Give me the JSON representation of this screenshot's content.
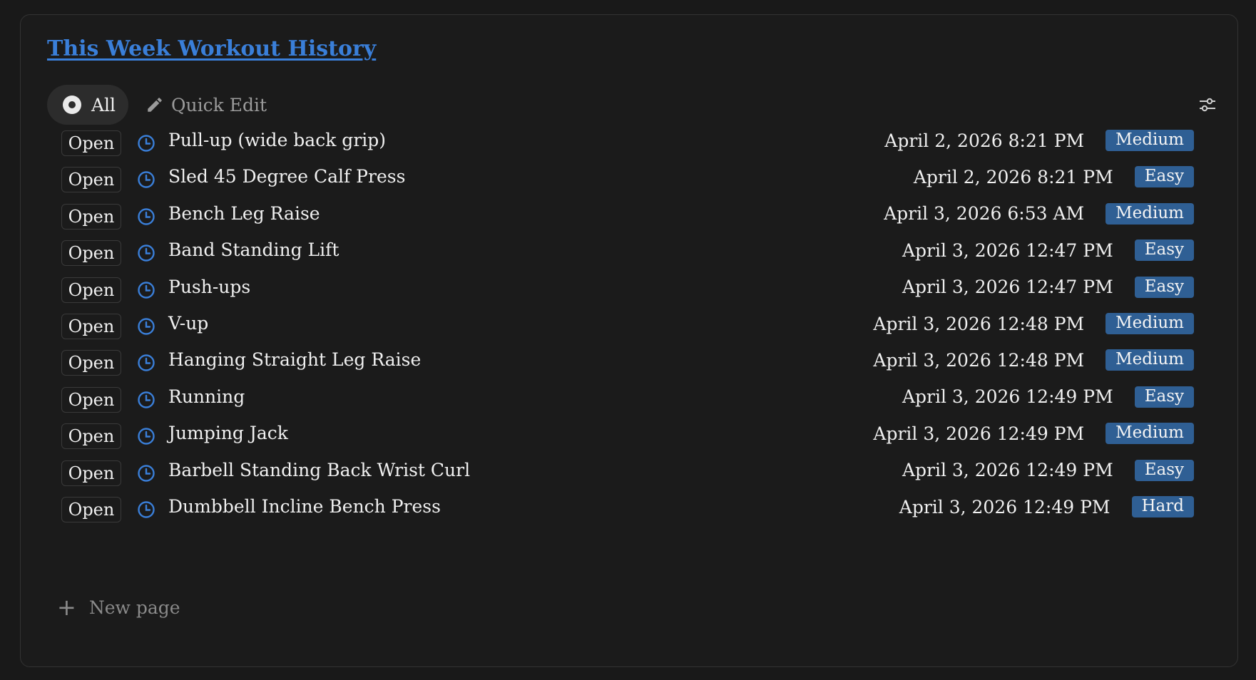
{
  "view": {
    "title": "This Week Workout History"
  },
  "toolbar": {
    "tab_all_label": "All",
    "quick_edit_label": "Quick Edit",
    "settings_icon": "sliders-icon"
  },
  "rows": [
    {
      "open_label": "Open",
      "name": "Pull-up (wide back grip)",
      "date": "April 2, 2026 8:21 PM",
      "difficulty": "Medium"
    },
    {
      "open_label": "Open",
      "name": "Sled 45 Degree Calf Press",
      "date": "April 2, 2026 8:21 PM",
      "difficulty": "Easy"
    },
    {
      "open_label": "Open",
      "name": "Bench Leg Raise",
      "date": "April 3, 2026 6:53 AM",
      "difficulty": "Medium"
    },
    {
      "open_label": "Open",
      "name": "Band Standing Lift",
      "date": "April 3, 2026 12:47 PM",
      "difficulty": "Easy"
    },
    {
      "open_label": "Open",
      "name": "Push-ups",
      "date": "April 3, 2026 12:47 PM",
      "difficulty": "Easy"
    },
    {
      "open_label": "Open",
      "name": "V-up",
      "date": "April 3, 2026 12:48 PM",
      "difficulty": "Medium"
    },
    {
      "open_label": "Open",
      "name": "Hanging Straight Leg Raise",
      "date": "April 3, 2026 12:48 PM",
      "difficulty": "Medium"
    },
    {
      "open_label": "Open",
      "name": "Running",
      "date": "April 3, 2026 12:49 PM",
      "difficulty": "Easy"
    },
    {
      "open_label": "Open",
      "name": "Jumping Jack",
      "date": "April 3, 2026 12:49 PM",
      "difficulty": "Medium"
    },
    {
      "open_label": "Open",
      "name": "Barbell Standing Back Wrist Curl",
      "date": "April 3, 2026 12:49 PM",
      "difficulty": "Easy"
    },
    {
      "open_label": "Open",
      "name": "Dumbbell Incline Bench Press",
      "date": "April 3, 2026 12:49 PM",
      "difficulty": "Hard"
    }
  ],
  "footer": {
    "new_page_label": "New page"
  },
  "colors": {
    "accent": "#3a7fd9",
    "badge_bg": "#2f5f94",
    "background": "#191919"
  }
}
